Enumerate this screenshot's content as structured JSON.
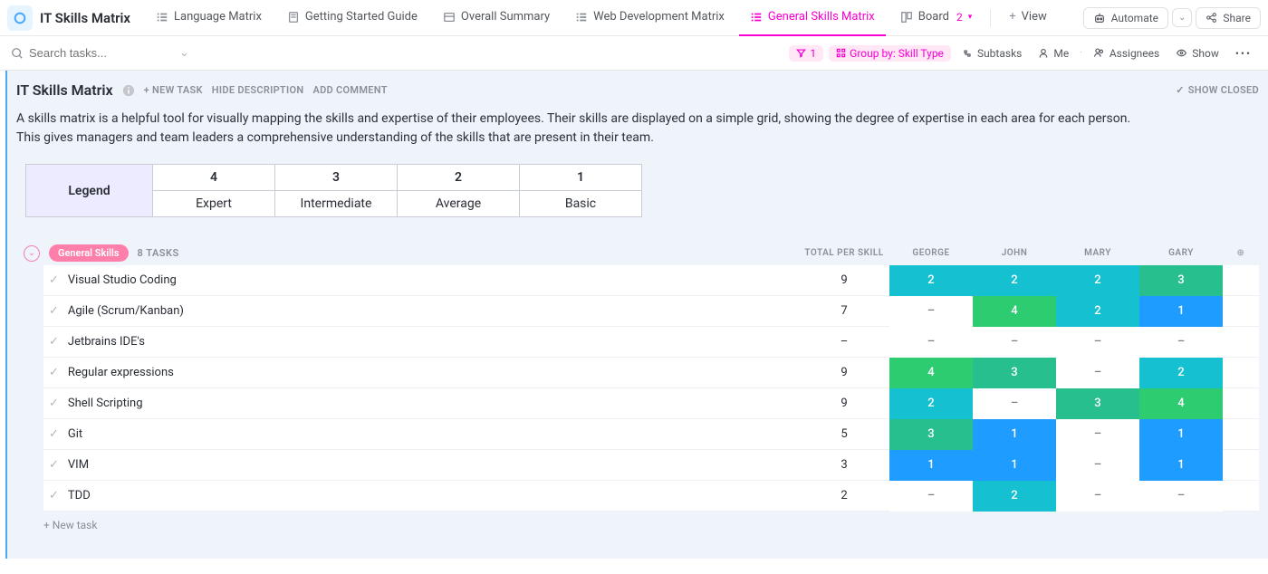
{
  "header": {
    "app_title": "IT Skills Matrix",
    "tabs": [
      {
        "label": "Language Matrix"
      },
      {
        "label": "Getting Started Guide"
      },
      {
        "label": "Overall Summary"
      },
      {
        "label": "Web Development Matrix"
      },
      {
        "label": "General Skills Matrix"
      },
      {
        "label": "Board",
        "count": "2"
      }
    ],
    "view_label": "View",
    "automate_label": "Automate",
    "share_label": "Share"
  },
  "filterbar": {
    "search_placeholder": "Search tasks...",
    "filter_count": "1",
    "group_by_label": "Group by: Skill Type",
    "subtasks_label": "Subtasks",
    "me_label": "Me",
    "assignees_label": "Assignees",
    "show_label": "Show"
  },
  "list": {
    "title": "IT Skills Matrix",
    "new_task_btn": "+ NEW TASK",
    "hide_desc_btn": "HIDE DESCRIPTION",
    "add_comment_btn": "ADD COMMENT",
    "show_closed_btn": "SHOW CLOSED",
    "description": "A skills matrix is a helpful tool for visually mapping the skills and expertise of their employees. Their skills are displayed on a simple grid, showing the degree of expertise in each area for each person. This gives managers and team leaders a comprehensive understanding of the skills that are present in their team."
  },
  "legend": {
    "header": "Legend",
    "ratings": [
      "4",
      "3",
      "2",
      "1"
    ],
    "labels": [
      "Expert",
      "Intermediate",
      "Average",
      "Basic"
    ]
  },
  "group": {
    "name": "General Skills",
    "count_label": "8 TASKS",
    "columns": {
      "total": "TOTAL PER SKILL",
      "people": [
        "GEORGE",
        "JOHN",
        "MARY",
        "GARY"
      ]
    },
    "tasks": [
      {
        "name": "Visual Studio Coding",
        "total": "9",
        "cells": [
          "2",
          "2",
          "2",
          "3"
        ]
      },
      {
        "name": "Agile (Scrum/Kanban)",
        "total": "7",
        "cells": [
          "–",
          "4",
          "2",
          "1"
        ]
      },
      {
        "name": "Jetbrains IDE's",
        "total": "–",
        "cells": [
          "–",
          "–",
          "–",
          "–"
        ]
      },
      {
        "name": "Regular expressions",
        "total": "9",
        "cells": [
          "4",
          "3",
          "–",
          "2"
        ]
      },
      {
        "name": "Shell Scripting",
        "total": "9",
        "cells": [
          "2",
          "–",
          "3",
          "4"
        ]
      },
      {
        "name": "Git",
        "total": "5",
        "cells": [
          "3",
          "1",
          "–",
          "1"
        ]
      },
      {
        "name": "VIM",
        "total": "3",
        "cells": [
          "1",
          "1",
          "–",
          "1"
        ]
      },
      {
        "name": "TDD",
        "total": "2",
        "cells": [
          "–",
          "2",
          "–",
          "–"
        ]
      }
    ],
    "new_task_label": "+ New task"
  },
  "colors": {
    "1": "#1f9cff",
    "2": "#15c1d0",
    "3": "#27bf8e",
    "4": "#2ecc71"
  }
}
